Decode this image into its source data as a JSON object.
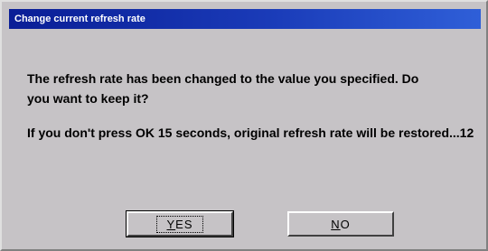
{
  "dialog": {
    "title": "Change current refresh rate",
    "message_line1": "The refresh rate has been changed to the value you specified. Do you want to keep it?",
    "message_line2": "If you don't press OK 15 seconds, original refresh rate will be restored...12",
    "yes_button": {
      "accel": "Y",
      "rest": "ES"
    },
    "no_button": {
      "accel": "N",
      "rest": "O"
    }
  }
}
